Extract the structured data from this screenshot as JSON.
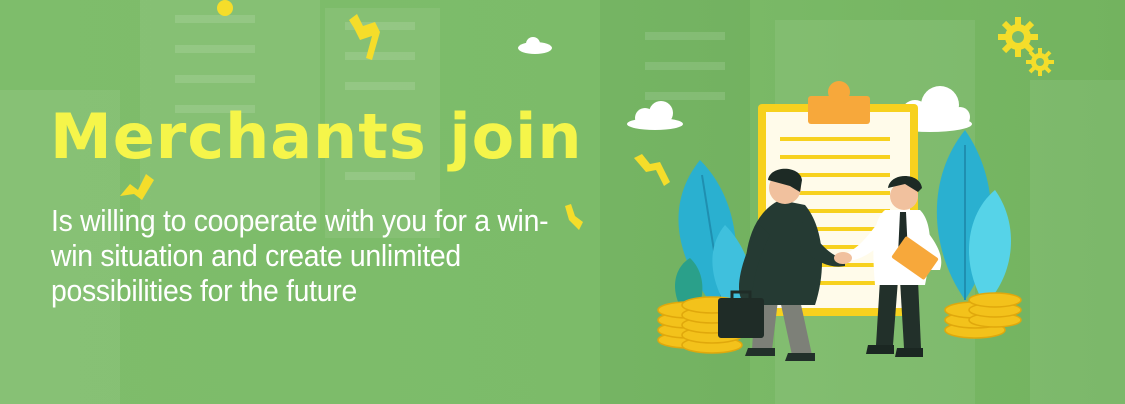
{
  "banner": {
    "title": "Merchants  join",
    "subtitle": "Is willing to cooperate with you for a win-win situation and create unlimited possibilities for the future"
  },
  "colors": {
    "background": "#7ebd6b",
    "title": "#f5f54a",
    "subtitle": "#ffffff",
    "accent_yellow": "#f7d11e",
    "clipboard_orange": "#f7a83b",
    "leaf_blue": "#3cb8d6",
    "coin_gold": "#f3c21b"
  },
  "illustration": {
    "elements": [
      "clipboard",
      "businessman-dark-suit",
      "businessman-white-shirt",
      "handshake",
      "briefcase",
      "folder",
      "coin-stacks",
      "plants",
      "clouds",
      "gears",
      "confetti"
    ]
  }
}
